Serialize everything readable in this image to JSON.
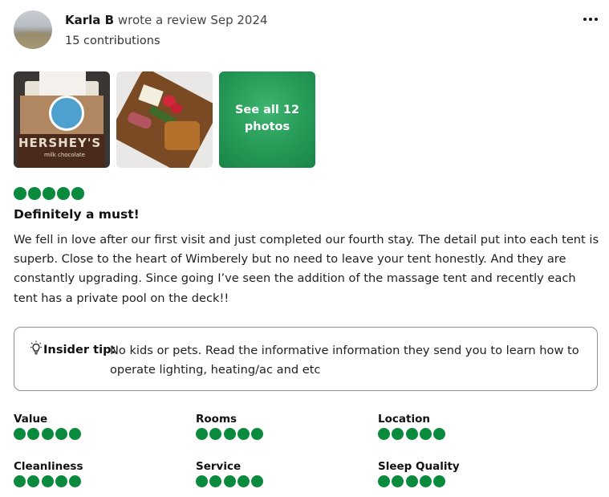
{
  "review": {
    "author": {
      "name": "Karla B",
      "action_text": "wrote a review Sep 2024",
      "contributions": "15 contributions"
    },
    "more_options_icon": "ellipsis-horizontal-icon",
    "photos": {
      "see_all_label": "See all 12\nphotos",
      "photo_1_text": "HERSHEY'S",
      "photo_1_subtext": "milk chocolate"
    },
    "rating": 5,
    "rating_max": 5,
    "title": "Definitely a must!",
    "body": "We fell in love after our first visit and just completed our fourth stay. The detail put into each tent is superb. Close to the heart of Wimberely but no need to leave your tent honestly. And they are constantly upgrading. Since going I’ve seen the addition of the massage tent and recently each tent has a private pool on the deck!!",
    "insider_tip": {
      "icon": "lightbulb-icon",
      "label": "Insider tip:",
      "text": "No kids or pets. Read the informative information they send you to learn how to operate lighting, heating/ac and etc"
    },
    "subratings": [
      {
        "label": "Value",
        "rating": 5
      },
      {
        "label": "Rooms",
        "rating": 5
      },
      {
        "label": "Location",
        "rating": 5
      },
      {
        "label": "Cleanliness",
        "rating": 5
      },
      {
        "label": "Service",
        "rating": 5
      },
      {
        "label": "Sleep Quality",
        "rating": 5
      }
    ],
    "colors": {
      "bubble_green": "#0a8a3d",
      "tip_border": "#8f8f8f"
    }
  }
}
